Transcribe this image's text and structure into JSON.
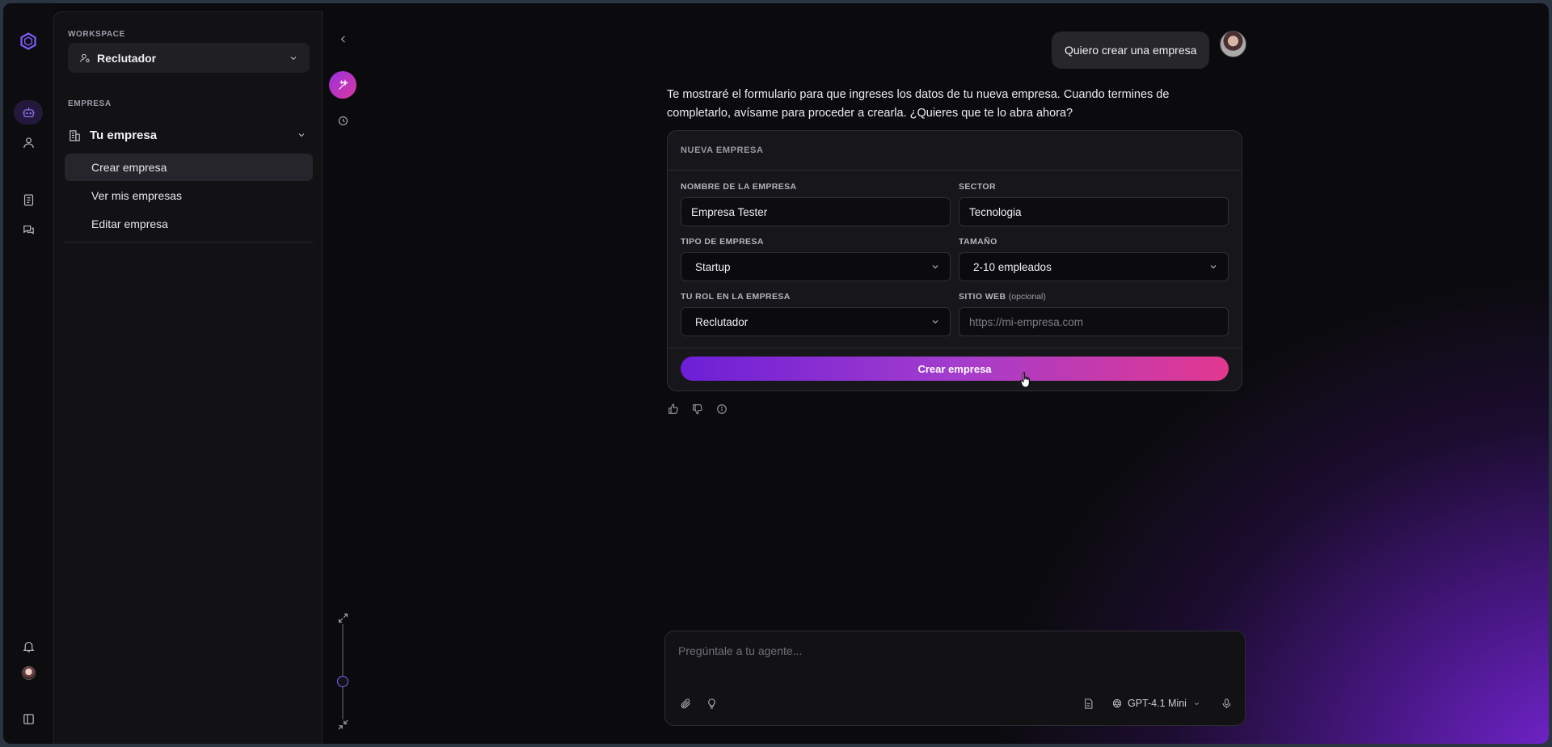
{
  "sidebar": {
    "workspace_label": "WORKSPACE",
    "workspace_value": "Reclutador",
    "section_label": "EMPRESA",
    "group_title": "Tu empresa",
    "items": [
      {
        "label": "Crear empresa",
        "active": true
      },
      {
        "label": "Ver mis empresas",
        "active": false
      },
      {
        "label": "Editar empresa",
        "active": false
      }
    ]
  },
  "rail": {
    "icons": [
      "logo-hexagon-icon",
      "bot-icon",
      "user-icon",
      "document-icon",
      "chat-icon",
      "bell-icon",
      "avatar",
      "sidebar-toggle-icon"
    ],
    "accent": "#7d5cff"
  },
  "chat": {
    "user_message": "Quiero crear una empresa",
    "assistant_message": "Te mostraré el formulario para que ingreses los datos de tu nueva empresa. Cuando termines de completarlo, avísame para proceder a crearla. ¿Quieres que te lo abra ahora?",
    "form": {
      "title": "NUEVA EMPRESA",
      "fields": {
        "nombre": {
          "label": "NOMBRE DE LA EMPRESA",
          "value": "Empresa Tester"
        },
        "sector": {
          "label": "SECTOR",
          "value": "Tecnologia"
        },
        "tipo": {
          "label": "TIPO DE EMPRESA",
          "value": "Startup"
        },
        "tamano": {
          "label": "TAMAÑO",
          "value": "2-10 empleados"
        },
        "rol": {
          "label": "TU ROL EN LA EMPRESA",
          "value": "Reclutador"
        },
        "web": {
          "label": "SITIO WEB",
          "optional": "(opcional)",
          "placeholder": "https://mi-empresa.com"
        }
      },
      "submit_label": "Crear empresa"
    }
  },
  "composer": {
    "placeholder": "Pregúntale a tu agente...",
    "model": "GPT-4.1 Mini"
  },
  "colors": {
    "button_gradient_start": "#6c1fd6",
    "button_gradient_end": "#e2388f",
    "background": "#0b0b0e"
  }
}
